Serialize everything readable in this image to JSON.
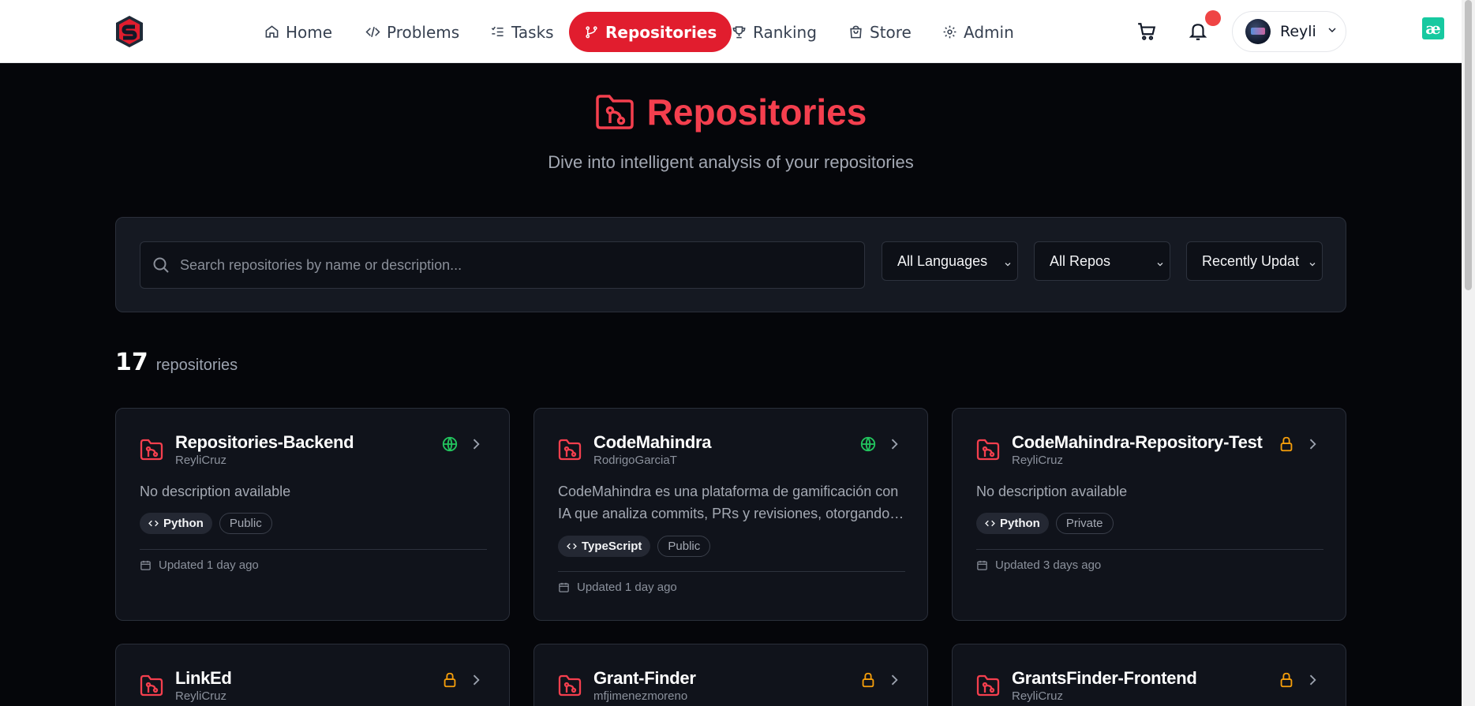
{
  "nav": {
    "items": [
      {
        "label": "Home",
        "icon": "home-icon"
      },
      {
        "label": "Problems",
        "icon": "code-icon"
      },
      {
        "label": "Tasks",
        "icon": "list-checks-icon"
      },
      {
        "label": "Repositories",
        "icon": "git-branch-icon",
        "active": true
      },
      {
        "label": "Ranking",
        "icon": "trophy-icon"
      },
      {
        "label": "Store",
        "icon": "shopping-bag-icon"
      },
      {
        "label": "Admin",
        "icon": "gear-icon"
      }
    ],
    "user_name": "Reyli",
    "extension_glyph": "æ"
  },
  "hero": {
    "title": "Repositories",
    "subtitle": "Dive into intelligent analysis of your repositories"
  },
  "filters": {
    "search_placeholder": "Search repositories by name or description...",
    "language": "All Languages",
    "repos": "All Repos",
    "sort": "Recently Updat"
  },
  "count": {
    "number": "17",
    "label": "repositories"
  },
  "repos": [
    {
      "name": "Repositories-Backend",
      "owner": "ReyliCruz",
      "description": "No description available",
      "language": "Python",
      "visibility": "Public",
      "updated": "Updated 1 day ago"
    },
    {
      "name": "CodeMahindra",
      "owner": "RodrigoGarciaT",
      "description": "CodeMahindra es una plataforma de gamificación con IA que analiza commits, PRs y revisiones, otorgando XP...",
      "language": "TypeScript",
      "visibility": "Public",
      "updated": "Updated 1 day ago"
    },
    {
      "name": "CodeMahindra-Repository-Test",
      "owner": "ReyliCruz",
      "description": "No description available",
      "language": "Python",
      "visibility": "Private",
      "updated": "Updated 3 days ago"
    },
    {
      "name": "LinkEd",
      "owner": "ReyliCruz",
      "visibility_icon": "lock-icon"
    },
    {
      "name": "Grant-Finder",
      "owner": "mfjimenezmoreno",
      "visibility_icon": "lock-icon"
    },
    {
      "name": "GrantsFinder-Frontend",
      "owner": "ReyliCruz",
      "visibility_icon": "lock-icon"
    }
  ],
  "colors": {
    "accent": "#e11d2e",
    "public_icon": "#22c55e",
    "private_icon": "#f59e0b"
  }
}
